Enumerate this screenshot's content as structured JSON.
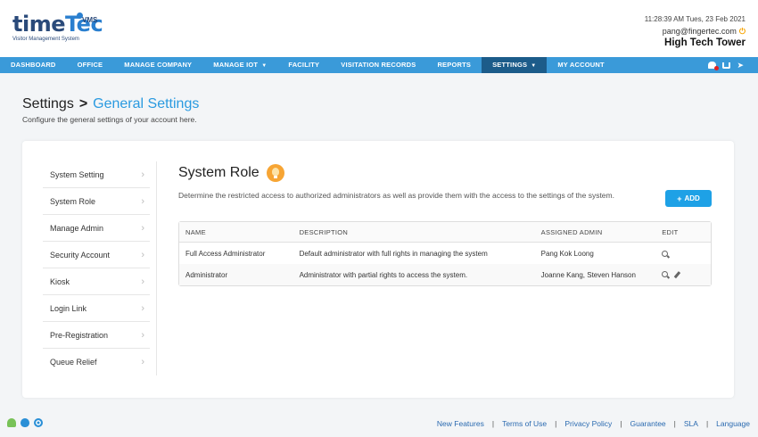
{
  "brand": {
    "name_part1": "time",
    "name_part2": "Tec",
    "badge": "VMS",
    "subtitle": "Visitor Management System"
  },
  "header": {
    "datetime": "11:28:39 AM  Tues, 23 Feb 2021",
    "email": "pang@fingertec.com",
    "site": "High Tech Tower"
  },
  "nav": {
    "items": [
      {
        "label": "DASHBOARD"
      },
      {
        "label": "OFFICE"
      },
      {
        "label": "MANAGE COMPANY"
      },
      {
        "label": "MANAGE IOT"
      },
      {
        "label": "FACILITY"
      },
      {
        "label": "VISITATION RECORDS"
      },
      {
        "label": "REPORTS"
      },
      {
        "label": "SETTINGS"
      },
      {
        "label": "MY ACCOUNT"
      }
    ],
    "active": "SETTINGS"
  },
  "page": {
    "title": "Settings",
    "separator": ">",
    "subtitle": "General Settings",
    "description": "Configure the general settings of your account here."
  },
  "sidebar": {
    "items": [
      {
        "label": "System Setting"
      },
      {
        "label": "System Role"
      },
      {
        "label": "Manage Admin"
      },
      {
        "label": "Security Account"
      },
      {
        "label": "Kiosk"
      },
      {
        "label": "Login Link"
      },
      {
        "label": "Pre-Registration"
      },
      {
        "label": "Queue Relief"
      }
    ]
  },
  "role": {
    "title": "System Role",
    "description": "Determine the restricted access to authorized administrators as well as provide them with the access to the settings of the system.",
    "add_label": "ADD"
  },
  "table": {
    "headers": {
      "name": "NAME",
      "description": "DESCRIPTION",
      "assigned": "ASSIGNED ADMIN",
      "edit": "EDIT"
    },
    "rows": [
      {
        "name": "Full Access Administrator",
        "description": "Default administrator with full rights in managing the system",
        "assigned": "Pang Kok Loong"
      },
      {
        "name": "Administrator",
        "description": "Administrator with partial rights to access the system.",
        "assigned": "Joanne Kang, Steven Hanson"
      }
    ]
  },
  "footer": {
    "links": [
      {
        "label": "New Features"
      },
      {
        "label": "Terms of Use"
      },
      {
        "label": "Privacy Policy"
      },
      {
        "label": "Guarantee"
      },
      {
        "label": "SLA"
      },
      {
        "label": "Language"
      }
    ],
    "separator": "|"
  },
  "colors": {
    "nav_bg": "#3a9ad9",
    "nav_active": "#1c5c8a",
    "accent": "#2a9ae0",
    "add_button": "#1ea1e6",
    "bulb": "#f7a534"
  },
  "icons": {
    "power": "power-icon",
    "bulb": "lightbulb-icon",
    "view": "search-icon",
    "edit": "pencil-icon"
  }
}
